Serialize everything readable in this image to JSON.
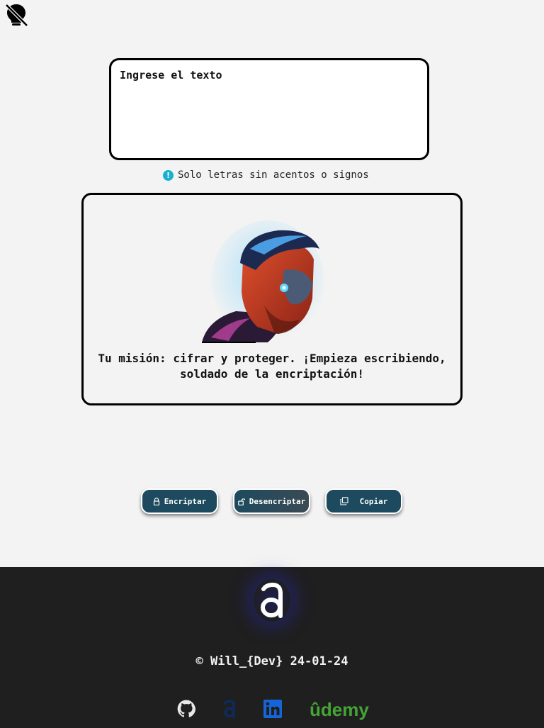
{
  "theme_toggle": {
    "icon": "lightbulb-off-icon"
  },
  "input": {
    "placeholder": "Ingrese el texto",
    "value": ""
  },
  "hint": {
    "icon": "info-icon",
    "text": "Solo letras sin acentos o signos",
    "icon_color": "#17b1cf"
  },
  "output": {
    "avatar": "terminator-avatar",
    "message": "Tu misión: cifrar y proteger. ¡Empieza escribiendo, soldado de la encriptación!"
  },
  "buttons": {
    "encrypt": {
      "label": "Encriptar",
      "icon": "lock-icon"
    },
    "decrypt": {
      "label": "Desencriptar",
      "icon": "unlock-icon"
    },
    "copy": {
      "label": "Copiar",
      "icon": "copy-icon"
    }
  },
  "footer": {
    "copyright": "© Will_{Dev} 24-01-24",
    "socials": {
      "github": {
        "icon": "github-icon"
      },
      "portfolio": {
        "icon": "portfolio-a-icon"
      },
      "linkedin": {
        "icon": "linkedin-icon"
      },
      "udemy": {
        "label": "ûdemy",
        "icon": "udemy-icon"
      }
    }
  },
  "colors": {
    "page_bg": "#f3f3f3",
    "button_bg": "#1d4a5e",
    "footer_bg": "#1f1f1f",
    "udemy_green": "#43a534",
    "linkedin_blue": "#1565d8",
    "portfolio_blue": "#0d2b5e"
  }
}
